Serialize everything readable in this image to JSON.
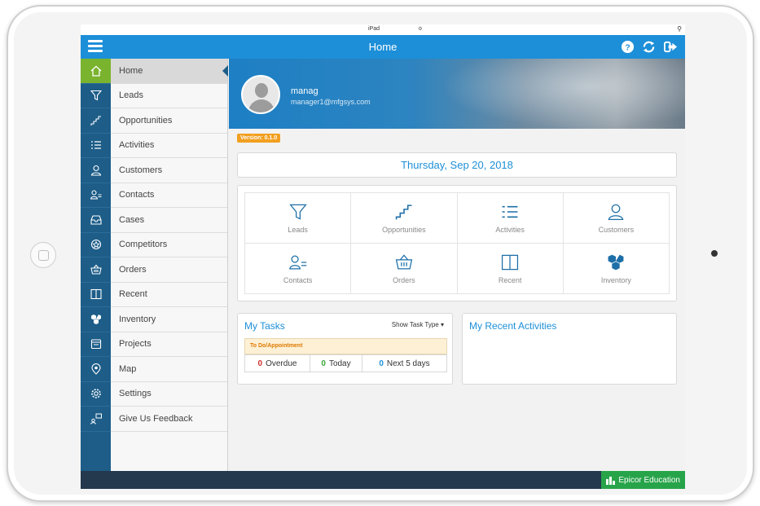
{
  "device": {
    "name": "iPad"
  },
  "navbar": {
    "title": "Home",
    "icons": [
      "menu-icon",
      "help-icon",
      "refresh-icon",
      "logout-icon"
    ]
  },
  "sidebar": {
    "items": [
      {
        "label": "Home",
        "icon": "home-icon",
        "active": true
      },
      {
        "label": "Leads",
        "icon": "filter-icon"
      },
      {
        "label": "Opportunities",
        "icon": "stairs-icon"
      },
      {
        "label": "Activities",
        "icon": "checklist-icon"
      },
      {
        "label": "Customers",
        "icon": "user-icon"
      },
      {
        "label": "Contacts",
        "icon": "contact-icon"
      },
      {
        "label": "Cases",
        "icon": "tray-icon"
      },
      {
        "label": "Competitors",
        "icon": "badge-icon"
      },
      {
        "label": "Orders",
        "icon": "basket-icon"
      },
      {
        "label": "Recent",
        "icon": "book-icon"
      },
      {
        "label": "Inventory",
        "icon": "boxes-icon"
      },
      {
        "label": "Projects",
        "icon": "projects-icon"
      },
      {
        "label": "Map",
        "icon": "map-pin-icon"
      },
      {
        "label": "Settings",
        "icon": "gear-icon"
      },
      {
        "label": "Give Us Feedback",
        "icon": "feedback-icon"
      }
    ]
  },
  "profile": {
    "name": "manag",
    "email": "manager1@mfgsys.com"
  },
  "version": "Version: 0.1.0",
  "date": "Thursday, Sep 20, 2018",
  "tiles": [
    {
      "label": "Leads",
      "icon": "filter-icon"
    },
    {
      "label": "Opportunities",
      "icon": "stairs-icon"
    },
    {
      "label": "Activities",
      "icon": "checklist-icon"
    },
    {
      "label": "Customers",
      "icon": "user-icon"
    },
    {
      "label": "Contacts",
      "icon": "contact-icon"
    },
    {
      "label": "Orders",
      "icon": "basket-icon"
    },
    {
      "label": "Recent",
      "icon": "book-icon"
    },
    {
      "label": "Inventory",
      "icon": "boxes-icon"
    }
  ],
  "tasks": {
    "title": "My Tasks",
    "filter_label": "Show Task Type ▾",
    "category": "To Do/Appointment",
    "counts": [
      {
        "value": "0",
        "label": "Overdue",
        "color": "#d0302f"
      },
      {
        "value": "0",
        "label": "Today",
        "color": "#3aa53a"
      },
      {
        "value": "0",
        "label": "Next 5 days",
        "color": "#1d8fd8"
      }
    ]
  },
  "recent": {
    "title": "My Recent Activities"
  },
  "footer": {
    "brand": "Epicor Education"
  },
  "colors": {
    "accent": "#1d8fd8",
    "sidebar": "#1d5d88",
    "active": "#7ab32e",
    "version": "#f29f20",
    "footer": "#24394e",
    "brand": "#27a44a"
  }
}
